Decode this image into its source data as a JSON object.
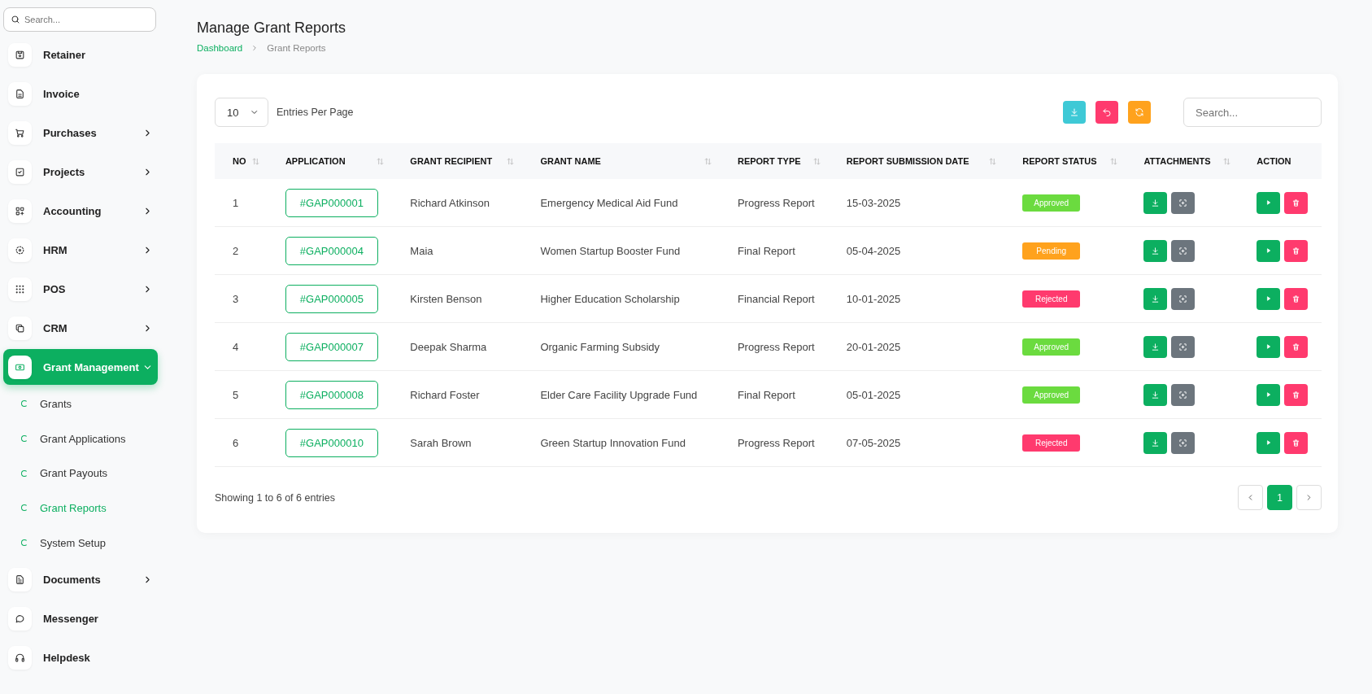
{
  "sidebar": {
    "search": {
      "placeholder": "Search..."
    },
    "items": [
      {
        "label": "Retainer",
        "submenu": false,
        "selected": false
      },
      {
        "label": "Invoice",
        "submenu": false,
        "selected": false
      },
      {
        "label": "Purchases",
        "submenu": true,
        "expanded": false,
        "selected": false
      },
      {
        "label": "Projects",
        "submenu": true,
        "expanded": false,
        "selected": false
      },
      {
        "label": "Accounting",
        "submenu": true,
        "expanded": false,
        "selected": false
      },
      {
        "label": "HRM",
        "submenu": true,
        "expanded": false,
        "selected": false
      },
      {
        "label": "POS",
        "submenu": true,
        "expanded": false,
        "selected": false
      },
      {
        "label": "CRM",
        "submenu": true,
        "expanded": false,
        "selected": false
      },
      {
        "label": "Grant Management",
        "submenu": true,
        "expanded": true,
        "selected": true,
        "children": [
          {
            "label": "Grants",
            "selected": false
          },
          {
            "label": "Grant Applications",
            "selected": false
          },
          {
            "label": "Grant Payouts",
            "selected": false
          },
          {
            "label": "Grant Reports",
            "selected": true
          },
          {
            "label": "System Setup",
            "selected": false
          }
        ]
      },
      {
        "label": "Documents",
        "submenu": true,
        "expanded": false,
        "selected": false
      },
      {
        "label": "Messenger",
        "submenu": false,
        "selected": false
      },
      {
        "label": "Helpdesk",
        "submenu": false,
        "selected": false
      }
    ]
  },
  "page": {
    "title": "Manage Grant Reports",
    "breadcrumb": [
      "Dashboard",
      "Grant Reports"
    ]
  },
  "toolbar": {
    "page_size": "10",
    "page_size_label": "Entries Per Page",
    "search": {
      "placeholder": "Search..."
    }
  },
  "table": {
    "columns": [
      "NO",
      "APPLICATION",
      "GRANT RECIPIENT",
      "GRANT NAME",
      "REPORT TYPE",
      "REPORT SUBMISSION DATE",
      "REPORT STATUS",
      "ATTACHMENTS",
      "ACTION"
    ],
    "rows": [
      {
        "no": "1",
        "application": "#GAP000001",
        "recipient": "Richard Atkinson",
        "grant": "Emergency Medical Aid Fund",
        "type": "Progress Report",
        "date": "15-03-2025",
        "status": "Approved",
        "color": "#6bdb3f"
      },
      {
        "no": "2",
        "application": "#GAP000004",
        "recipient": "Maia",
        "grant": "Women Startup Booster Fund",
        "type": "Final Report",
        "date": "05-04-2025",
        "status": "Pending",
        "color": "#ffa21d"
      },
      {
        "no": "3",
        "application": "#GAP000005",
        "recipient": "Kirsten Benson",
        "grant": "Higher Education Scholarship",
        "type": "Financial Report",
        "date": "10-01-2025",
        "status": "Rejected",
        "color": "#ff3a6e"
      },
      {
        "no": "4",
        "application": "#GAP000007",
        "recipient": "Deepak Sharma",
        "grant": "Organic Farming Subsidy",
        "type": "Progress Report",
        "date": "20-01-2025",
        "status": "Approved",
        "color": "#6bdb3f"
      },
      {
        "no": "5",
        "application": "#GAP000008",
        "recipient": "Richard Foster",
        "grant": "Elder Care Facility Upgrade Fund",
        "type": "Final Report",
        "date": "05-01-2025",
        "status": "Approved",
        "color": "#6bdb3f"
      },
      {
        "no": "6",
        "application": "#GAP000010",
        "recipient": "Sarah Brown",
        "grant": "Green Startup Innovation Fund",
        "type": "Progress Report",
        "date": "07-05-2025",
        "status": "Rejected",
        "color": "#ff3a6e"
      }
    ]
  },
  "footer": {
    "summary": "Showing 1 to 6 of 6 entries",
    "pages": [
      {
        "label": "1",
        "selected": true
      }
    ]
  }
}
